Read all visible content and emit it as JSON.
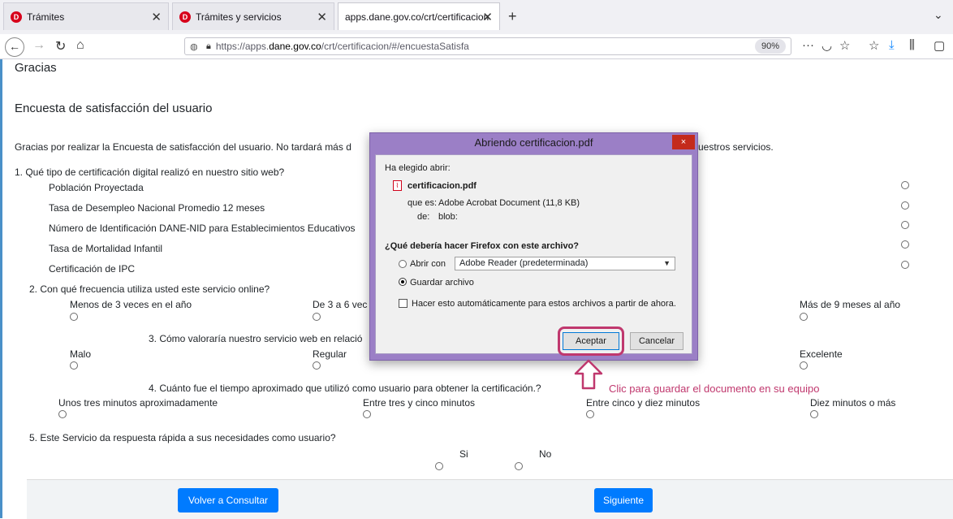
{
  "browser": {
    "tabs": [
      {
        "label": "Trámites",
        "active": false
      },
      {
        "label": "Trámites y servicios",
        "active": false
      },
      {
        "label": "apps.dane.gov.co/crt/certificacion",
        "active": true
      }
    ],
    "url_prefix": "https://apps.",
    "url_domain": "dane.gov.co",
    "url_path": "/crt/certificacion/#/encuestaSatisfa",
    "zoom": "90%",
    "favicon_letter": "D"
  },
  "page": {
    "gracias": "Gracias",
    "survey_title": "Encuesta de satisfacción del usuario",
    "intro_left": "Gracias por realizar la Encuesta de satisfacción del usuario. No tardará más d",
    "intro_right": "uestros servicios.",
    "q1": {
      "question": "1. Qué tipo de certificación digital realizó en nuestro sitio web?",
      "options": [
        "Población Proyectada",
        "Tasa de Desempleo Nacional Promedio 12 meses",
        "Número de Identificación DANE-NID para Establecimientos Educativos",
        "Tasa de Mortalidad Infantil",
        "Certificación de IPC"
      ]
    },
    "q2": {
      "question": "2. Con qué frecuencia utiliza usted este servicio online?",
      "options": [
        "Menos de 3 veces en el año",
        "De 3 a 6 vec",
        "Más de 9 meses al año"
      ]
    },
    "q3": {
      "question": "3. Cómo valoraría nuestro servicio web en relació",
      "options": [
        "Malo",
        "Regular",
        "Excelente"
      ]
    },
    "q4": {
      "question": "4. Cuánto fue el tiempo aproximado que utilizó como usuario para obtener la certificación.?",
      "options": [
        "Unos tres minutos aproximadamente",
        "Entre tres y cinco minutos",
        "Entre cinco y diez minutos",
        "Diez minutos o más"
      ]
    },
    "q5": {
      "question": "5. Este Servicio da respuesta rápida a sus necesidades como usuario?",
      "options": [
        "Si",
        "No"
      ]
    },
    "footer": {
      "back_label": "Volver a Consultar",
      "next_label": "Siguiente"
    }
  },
  "dialog": {
    "title": "Abriendo certificacion.pdf",
    "close_label": "×",
    "chosen_label": "Ha elegido abrir:",
    "filename": "certificacion.pdf",
    "type_label": "que es:",
    "type_value": "Adobe Acrobat Document (11,8 KB)",
    "from_label": "de:",
    "from_value": "blob:",
    "question": "¿Qué debería hacer Firefox con este archivo?",
    "open_with_label": "Abrir con",
    "open_with_value": "Adobe Reader (predeterminada)",
    "save_label": "Guardar archivo",
    "auto_label": "Hacer esto automáticamente para estos archivos a partir de ahora.",
    "accept_label": "Aceptar",
    "cancel_label": "Cancelar"
  },
  "annotation": {
    "callout": "Clic para guardar el documento en su equipo",
    "color": "#c0386e"
  }
}
